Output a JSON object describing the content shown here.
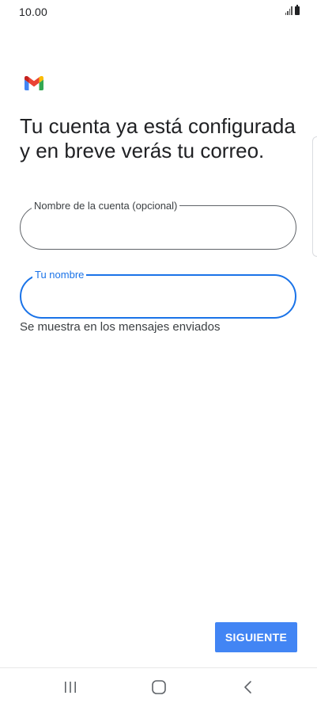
{
  "status_bar": {
    "time": "10.00"
  },
  "app": {
    "logo_icon": "gmail-logo-icon"
  },
  "page": {
    "title": "Tu cuenta ya está configurada y en breve verás tu correo."
  },
  "form": {
    "account_name": {
      "label": "Nombre de la cuenta (opcional)",
      "value": "",
      "placeholder": ""
    },
    "your_name": {
      "label": "Tu nombre",
      "value": "",
      "placeholder": "",
      "helper": "Se muestra en los mensajes enviados"
    }
  },
  "actions": {
    "next_label": "SIGUIENTE"
  },
  "navigation": {
    "items": [
      "recents-icon",
      "home-icon",
      "back-icon"
    ]
  },
  "colors": {
    "accent": "#1a73e8",
    "button": "#4285f4",
    "text": "#202124"
  }
}
